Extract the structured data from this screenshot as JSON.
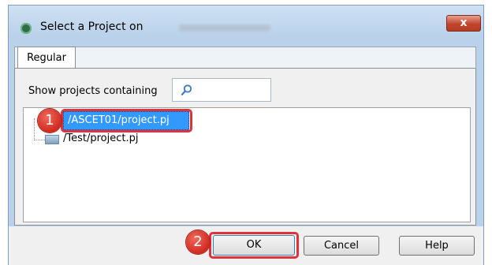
{
  "window": {
    "title": "Select a Project on",
    "close_glyph": "x"
  },
  "tabs": [
    {
      "label": "Regular",
      "active": true
    }
  ],
  "filter": {
    "label": "Show projects containing",
    "value": ""
  },
  "project_list": [
    {
      "label": "/ASCET01/project.pj",
      "selected": true
    },
    {
      "label": "/Test/project.pj",
      "selected": false
    }
  ],
  "buttons": {
    "ok": "OK",
    "cancel": "Cancel",
    "help": "Help"
  },
  "annotations": {
    "step1": "1",
    "step2": "2"
  },
  "colors": {
    "selection": "#3399ff",
    "annotation_red": "#e0323a",
    "titlebar": "#c9dcf0"
  },
  "icons": [
    "app-icon",
    "close-icon",
    "search-icon",
    "folder-icon"
  ]
}
